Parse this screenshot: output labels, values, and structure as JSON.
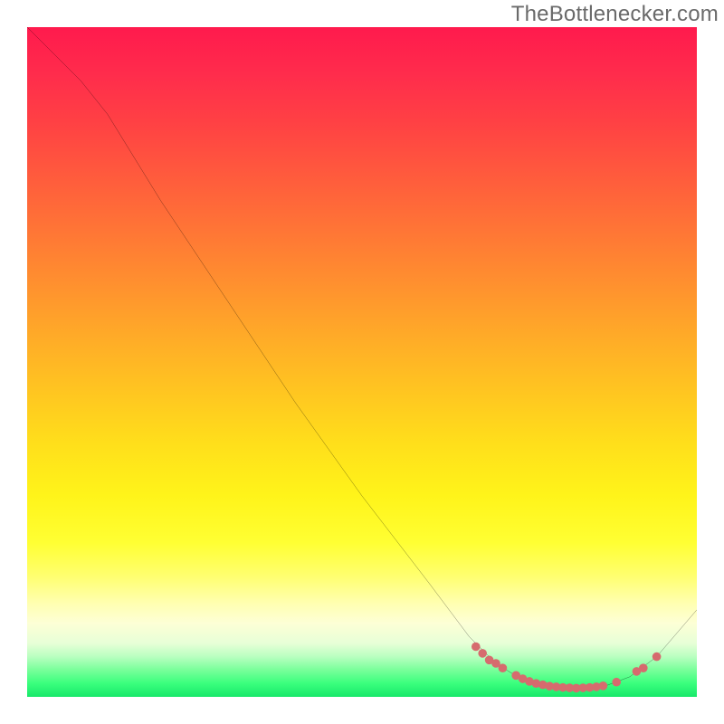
{
  "watermark": "TheBottlenecker.com",
  "chart_data": {
    "type": "line",
    "title": "",
    "xlabel": "",
    "ylabel": "",
    "xlim": [
      0,
      100
    ],
    "ylim": [
      0,
      100
    ],
    "curve": [
      {
        "x": 0,
        "y": 100
      },
      {
        "x": 8,
        "y": 92
      },
      {
        "x": 12,
        "y": 87
      },
      {
        "x": 20,
        "y": 74
      },
      {
        "x": 30,
        "y": 59
      },
      {
        "x": 40,
        "y": 44
      },
      {
        "x": 50,
        "y": 30
      },
      {
        "x": 60,
        "y": 17
      },
      {
        "x": 66,
        "y": 9
      },
      {
        "x": 70,
        "y": 5
      },
      {
        "x": 74,
        "y": 2.5
      },
      {
        "x": 78,
        "y": 1.5
      },
      {
        "x": 82,
        "y": 1.3
      },
      {
        "x": 86,
        "y": 1.5
      },
      {
        "x": 90,
        "y": 3
      },
      {
        "x": 94,
        "y": 6
      },
      {
        "x": 100,
        "y": 13
      }
    ],
    "highlight_points": [
      {
        "x": 67,
        "y": 7.5
      },
      {
        "x": 68,
        "y": 6.5
      },
      {
        "x": 69,
        "y": 5.5
      },
      {
        "x": 70,
        "y": 5.0
      },
      {
        "x": 71,
        "y": 4.3
      },
      {
        "x": 73,
        "y": 3.2
      },
      {
        "x": 74,
        "y": 2.7
      },
      {
        "x": 75,
        "y": 2.3
      },
      {
        "x": 76,
        "y": 2.0
      },
      {
        "x": 77,
        "y": 1.8
      },
      {
        "x": 78,
        "y": 1.6
      },
      {
        "x": 79,
        "y": 1.5
      },
      {
        "x": 80,
        "y": 1.4
      },
      {
        "x": 81,
        "y": 1.35
      },
      {
        "x": 82,
        "y": 1.3
      },
      {
        "x": 83,
        "y": 1.35
      },
      {
        "x": 84,
        "y": 1.4
      },
      {
        "x": 85,
        "y": 1.5
      },
      {
        "x": 86,
        "y": 1.65
      },
      {
        "x": 88,
        "y": 2.2
      },
      {
        "x": 91,
        "y": 3.8
      },
      {
        "x": 92,
        "y": 4.3
      },
      {
        "x": 94,
        "y": 6.0
      }
    ],
    "colors": {
      "curve": "#000000",
      "points": "#d66b6e",
      "gradient_top": "#ff1a4d",
      "gradient_bottom": "#17e86a"
    }
  }
}
